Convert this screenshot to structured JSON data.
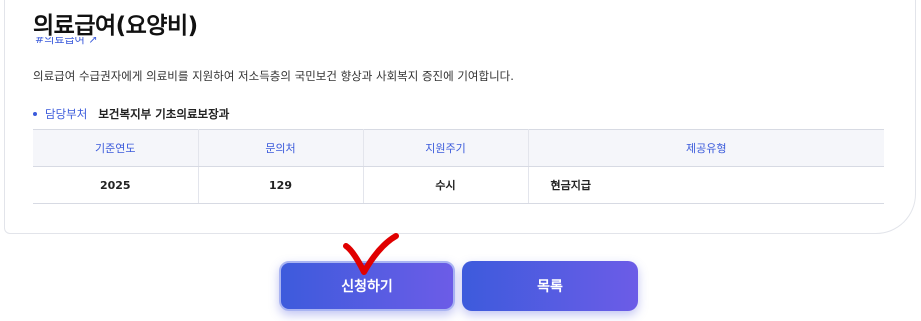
{
  "page": {
    "title": "의료급여(요양비)",
    "hashtag": "#의료급여",
    "hashtag_icon": "external-link-icon",
    "description": "의료급여 수급권자에게 의료비를 지원하여 저소득층의 국민보건 향상과 사회복지 증진에 기여합니다."
  },
  "department": {
    "label": "담당부처",
    "value": "보건복지부 기초의료보장과"
  },
  "table": {
    "headers": [
      "기준연도",
      "문의처",
      "지원주기",
      "제공유형"
    ],
    "row": [
      "2025",
      "129",
      "수시",
      "현금지급"
    ]
  },
  "buttons": {
    "apply": "신청하기",
    "list": "목록"
  },
  "colors": {
    "accent": "#3b5bdb",
    "button_gradient_start": "#3d5bdc",
    "button_gradient_end": "#6c5ce7",
    "annotation_mark": "#e00000"
  }
}
